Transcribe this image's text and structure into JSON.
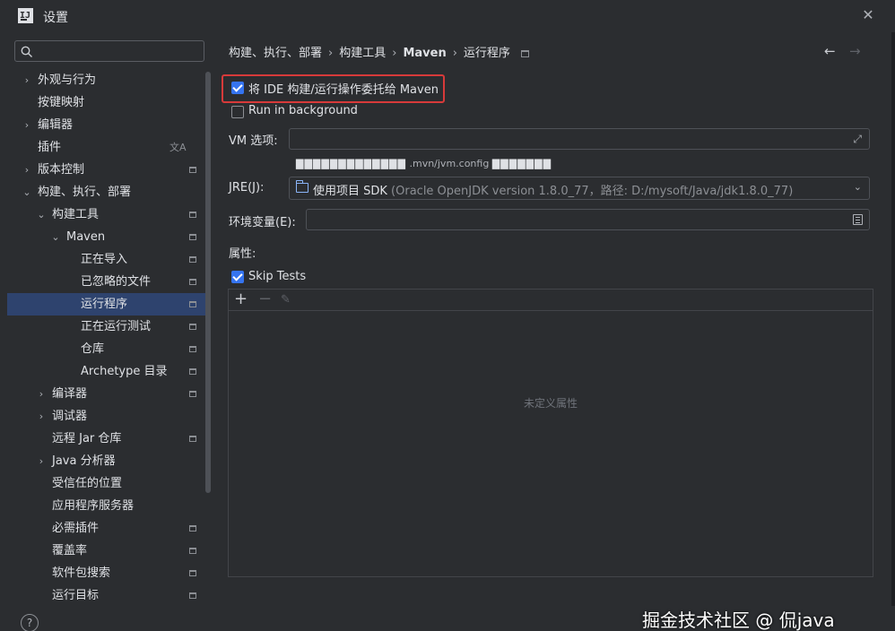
{
  "window": {
    "title": "设置",
    "logo_text": "IJ",
    "close_glyph": "✕"
  },
  "search": {
    "icon": "search-icon",
    "placeholder": ""
  },
  "tree": [
    {
      "label": "外观与行为",
      "arrow": "›",
      "badge": false
    },
    {
      "label": "按键映射",
      "arrow": "",
      "badge": false
    },
    {
      "label": "编辑器",
      "arrow": "›",
      "badge": false
    },
    {
      "label": "插件",
      "arrow": "",
      "badge": false,
      "trans_badge": "文A"
    },
    {
      "label": "版本控制",
      "arrow": "›",
      "badge": true
    },
    {
      "label": "构建、执行、部署",
      "arrow": "⌄",
      "badge": false
    },
    {
      "label": "构建工具",
      "arrow": "⌄",
      "badge": true
    },
    {
      "label": "Maven",
      "arrow": "⌄",
      "badge": true
    },
    {
      "label": "正在导入",
      "arrow": "",
      "badge": true
    },
    {
      "label": "已忽略的文件",
      "arrow": "",
      "badge": true
    },
    {
      "label": "运行程序",
      "arrow": "",
      "badge": true,
      "selected": true
    },
    {
      "label": "正在运行测试",
      "arrow": "",
      "badge": true
    },
    {
      "label": "仓库",
      "arrow": "",
      "badge": true
    },
    {
      "label": "Archetype 目录",
      "arrow": "",
      "badge": true
    },
    {
      "label": "编译器",
      "arrow": "›",
      "badge": true
    },
    {
      "label": "调试器",
      "arrow": "›",
      "badge": false
    },
    {
      "label": "远程 Jar 仓库",
      "arrow": "",
      "badge": true
    },
    {
      "label": "Java 分析器",
      "arrow": "›",
      "badge": false
    },
    {
      "label": "受信任的位置",
      "arrow": "",
      "badge": false
    },
    {
      "label": "应用程序服务器",
      "arrow": "",
      "badge": false
    },
    {
      "label": "必需插件",
      "arrow": "",
      "badge": true
    },
    {
      "label": "覆盖率",
      "arrow": "",
      "badge": true
    },
    {
      "label": "软件包搜索",
      "arrow": "",
      "badge": true
    },
    {
      "label": "运行目标",
      "arrow": "",
      "badge": true
    }
  ],
  "help": {
    "glyph": "?"
  },
  "breadcrumb": {
    "items": [
      "构建、执行、部署",
      "构建工具",
      "Maven",
      "运行程序"
    ],
    "separator": "›",
    "back_glyph": "←",
    "forward_glyph": "→"
  },
  "form": {
    "delegate_label": "将 IDE 构建/运行操作委托给 Maven",
    "delegate_checked": true,
    "background_label": "Run in background",
    "background_checked": false,
    "vm_label": "VM 选项:",
    "vm_value": "",
    "expand_glyph": "⤢",
    "hint_garble_left": "▇▇▇▇▇▇▇▇▇▇▇▇▇",
    "hint_text": " .mvn/jvm.config ",
    "hint_garble_right": "▇▇▇▇▇▇▇",
    "jre_label": "JRE(J):",
    "jre_value": "使用项目 SDK",
    "jre_detail": " (Oracle OpenJDK version 1.8.0_77，路径: D:/mysoft/Java/jdk1.8.0_77)",
    "dropdown_glyph": "⌄",
    "env_label": "环境变量(E):",
    "env_value": "",
    "props_label": "属性:",
    "skip_tests_label": "Skip Tests",
    "skip_tests_checked": true
  },
  "props_table": {
    "add_glyph": "+",
    "remove_glyph": "−",
    "edit_glyph": "✎",
    "empty_text": "未定义属性"
  },
  "watermark": "掘金技术社区 @ 侃java",
  "colors": {
    "background": "#2b2d30",
    "selection": "#2e436e",
    "accent": "#3574f0",
    "highlight": "#d73a3a"
  }
}
